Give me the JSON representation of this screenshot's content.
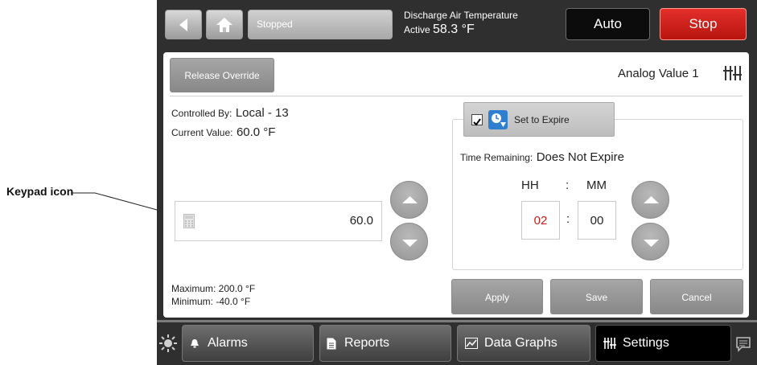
{
  "annotation": {
    "label": "Keypad icon"
  },
  "header": {
    "status": "Stopped",
    "point_title": "Discharge Air Temperature",
    "point_state": "Active",
    "point_value": "58.3 °F",
    "auto_label": "Auto",
    "stop_label": "Stop"
  },
  "panel": {
    "release_label": "Release Override",
    "object_name": "Analog Value 1",
    "controlled_by_label": "Controlled By:",
    "controlled_by_value": "Local - 13",
    "current_value_label": "Current Value:",
    "current_value_value": "60.0 °F",
    "entry_value": "60.0",
    "maximum": "Maximum: 200.0 °F",
    "minimum": "Minimum: -40.0 °F"
  },
  "expire": {
    "checkbox_checked": true,
    "label": "Set to Expire",
    "time_remaining_label": "Time Remaining:",
    "time_remaining_value": "Does Not Expire",
    "hh_label": "HH",
    "mm_label": "MM",
    "separator": ":",
    "hours": "02",
    "minutes": "00"
  },
  "actions": {
    "apply": "Apply",
    "save": "Save",
    "cancel": "Cancel"
  },
  "nav": {
    "alarms": "Alarms",
    "reports": "Reports",
    "data_graphs": "Data Graphs",
    "settings": "Settings"
  },
  "colors": {
    "stop_red": "#d1221c",
    "hours_red": "#c0201a",
    "accent_blue": "#2f7fd0"
  }
}
